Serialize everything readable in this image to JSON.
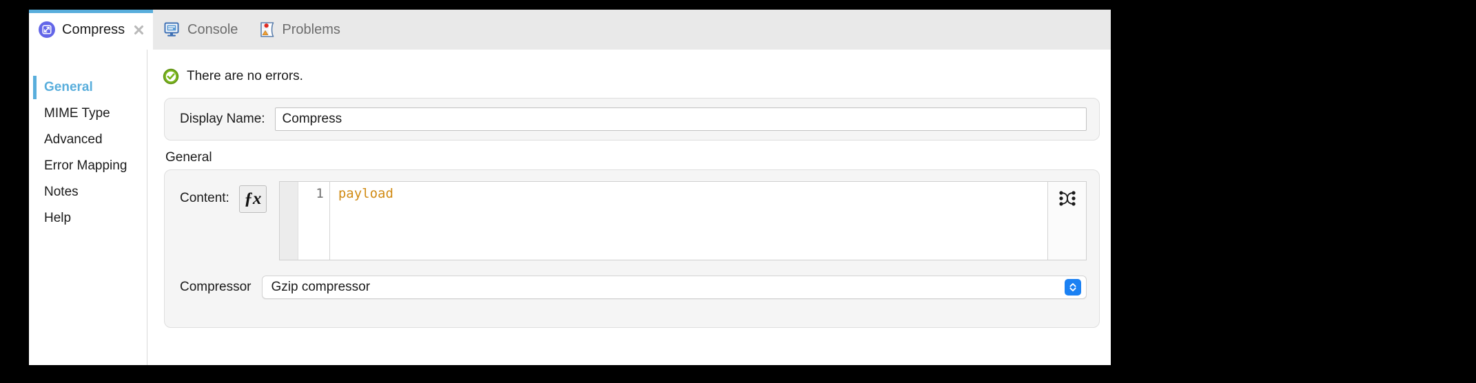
{
  "window": {
    "tabs": [
      {
        "label": "Compress",
        "icon": "compress-icon",
        "active": true,
        "closable": true
      },
      {
        "label": "Console",
        "icon": "console-icon",
        "active": false,
        "closable": false
      },
      {
        "label": "Problems",
        "icon": "problems-icon",
        "active": false,
        "closable": false
      }
    ]
  },
  "sidebar": {
    "items": [
      {
        "label": "General"
      },
      {
        "label": "MIME Type"
      },
      {
        "label": "Advanced"
      },
      {
        "label": "Error Mapping"
      },
      {
        "label": "Notes"
      },
      {
        "label": "Help"
      }
    ],
    "selected": "General"
  },
  "status": {
    "icon": "check-circle-icon",
    "message": "There are no errors."
  },
  "display_name": {
    "label": "Display Name:",
    "value": "Compress",
    "placeholder": ""
  },
  "general_section": {
    "title": "General",
    "content": {
      "label": "Content:",
      "fx_label": "ƒx",
      "line_number": "1",
      "code": "payload",
      "tool_icon": "dataweave-icon"
    },
    "compressor": {
      "label": "Compressor",
      "value": "Gzip compressor",
      "options": [
        "Gzip compressor"
      ]
    }
  },
  "colors": {
    "accent": "#59AEDC",
    "tabbar_bg": "#e9e9e9",
    "panel_bg": "#f5f5f5",
    "code_orange": "#d18b14",
    "stepper_blue": "#1b81f3",
    "status_green": "#74b71b"
  }
}
